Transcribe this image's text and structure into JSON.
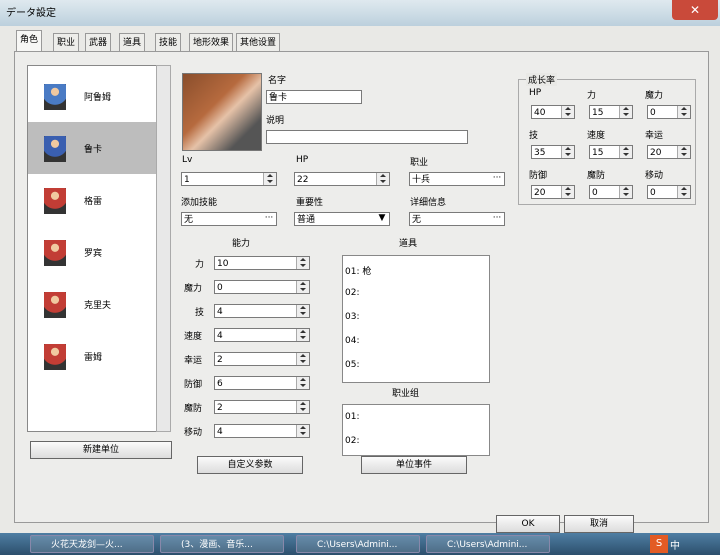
{
  "window": {
    "title": "データ設定",
    "close": "✕"
  },
  "tabs": [
    "角色",
    "职业",
    "武器",
    "道具",
    "技能",
    "地形效果",
    "其他设置"
  ],
  "characters": [
    "阿鲁姆",
    "鲁卡",
    "格雷",
    "罗宾",
    "克里夫",
    "雷姆"
  ],
  "new_unit": "新建单位",
  "form": {
    "name_label": "名字",
    "name_value": "鲁卡",
    "desc_label": "说明",
    "desc_value": "",
    "lv_label": "Lv",
    "lv_value": "1",
    "hp_label": "HP",
    "hp_value": "22",
    "job_label": "职业",
    "job_value": "十兵",
    "addskill_label": "添加技能",
    "addskill_value": "无",
    "importance_label": "重要性",
    "importance_value": "普通",
    "detail_label": "详细信息",
    "detail_value": "无"
  },
  "ability": {
    "title": "能力",
    "stats": [
      {
        "label": "力",
        "value": "10"
      },
      {
        "label": "魔力",
        "value": "0"
      },
      {
        "label": "技",
        "value": "4"
      },
      {
        "label": "速度",
        "value": "4"
      },
      {
        "label": "幸运",
        "value": "2"
      },
      {
        "label": "防御",
        "value": "6"
      },
      {
        "label": "魔防",
        "value": "2"
      },
      {
        "label": "移动",
        "value": "4"
      }
    ]
  },
  "items": {
    "title": "道具",
    "slots": [
      "01: 枪",
      "02:",
      "03:",
      "04:",
      "05:"
    ]
  },
  "jobgroup": {
    "title": "职业组",
    "slots": [
      "01:",
      "02:"
    ]
  },
  "custom_params": "自定义参数",
  "unit_event": "单位事件",
  "growth": {
    "title": "成长率",
    "stats": [
      {
        "label": "HP",
        "value": "40"
      },
      {
        "label": "力",
        "value": "15"
      },
      {
        "label": "魔力",
        "value": "0"
      },
      {
        "label": "技",
        "value": "35"
      },
      {
        "label": "速度",
        "value": "15"
      },
      {
        "label": "幸运",
        "value": "20"
      },
      {
        "label": "防御",
        "value": "20"
      },
      {
        "label": "魔防",
        "value": "0"
      },
      {
        "label": "移动",
        "value": "0"
      }
    ]
  },
  "ok": "OK",
  "cancel": "取消",
  "taskbar": [
    "火花天龙剑—火...",
    "(3、漫画、音乐...",
    "C:\\Users\\Admini...",
    "C:\\Users\\Admini..."
  ],
  "tray": "中"
}
